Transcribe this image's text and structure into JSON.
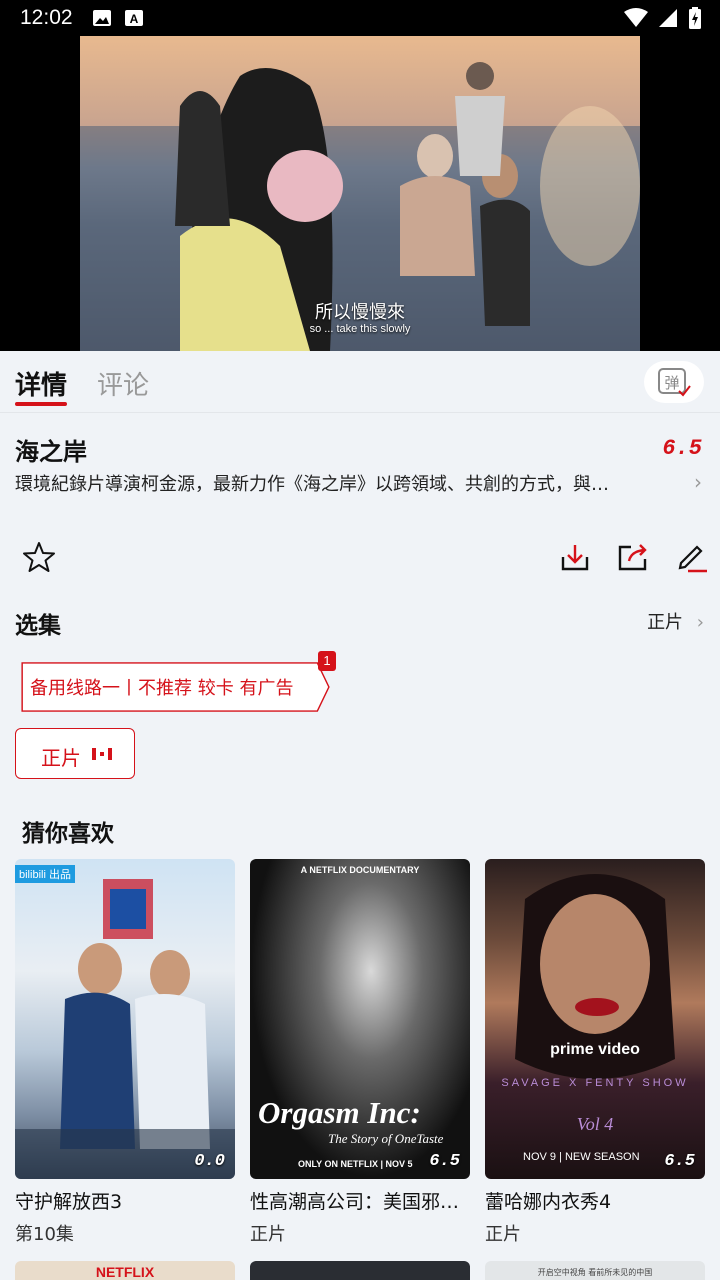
{
  "status": {
    "time": "12:02"
  },
  "video": {
    "subtitle_main": "所以慢慢來",
    "subtitle_en": "so ... take this slowly"
  },
  "tabs": {
    "details": "详情",
    "comments": "评论",
    "danmaku": "弹"
  },
  "show": {
    "title": "海之岸",
    "score": "6.5",
    "description": "環境紀錄片導演柯金源，最新力作《海之岸》以跨領域、共創的方式，與…"
  },
  "episodes": {
    "section_title": "选集",
    "right_label": "正片",
    "route_label": "备用线路一丨不推荐 较卡 有广告",
    "route_badge": "1",
    "episode_button": "正片"
  },
  "recommend": {
    "section_title": "猜你喜欢",
    "items": [
      {
        "title": "守护解放西3",
        "sub": "第10集",
        "score": "0.0",
        "poster_text": "bilibili 出品"
      },
      {
        "title": "性高潮高公司：美国邪…",
        "sub": "正片",
        "score": "6.5",
        "poster_top": "A NETFLIX DOCUMENTARY",
        "poster_title": "Orgasm Inc:",
        "poster_subtitle": "The Story of OneTaste",
        "poster_bottom": "ONLY ON NETFLIX | NOV 5"
      },
      {
        "title": "蕾哈娜内衣秀4",
        "sub": "正片",
        "score": "6.5",
        "poster_brand": "prime video",
        "poster_show": "SAVAGE X FENTY SHOW",
        "poster_vol": "Vol 4",
        "poster_bottom": "NOV 9 | NEW SEASON"
      }
    ],
    "next_row_top_text_1": "NETFLIX",
    "next_row_top_text_3": "开启空中视角 看前所未见的中国"
  },
  "colors": {
    "accent": "#d5121a",
    "background": "#f0f3f7"
  },
  "icons": [
    "gallery-icon",
    "text-icon",
    "wifi-icon",
    "signal-icon",
    "battery-icon",
    "star-icon",
    "download-icon",
    "share-icon",
    "edit-icon",
    "chevron-right-icon",
    "danmaku-icon"
  ]
}
